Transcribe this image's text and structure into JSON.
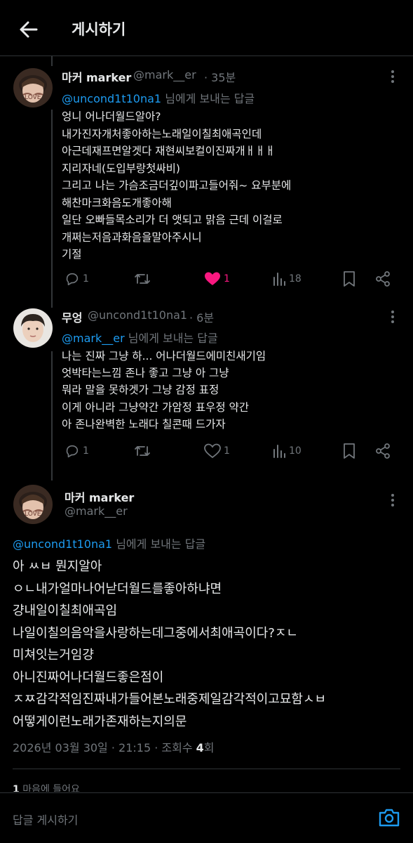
{
  "header": {
    "title": "게시하기",
    "back_icon": "arrow-left-icon"
  },
  "replying_label": "님에게 보내는 답글",
  "tweets": [
    {
      "name": "마커 marker",
      "handle": "@mark__er",
      "time": "· 35분",
      "reply_to": "@uncond1t10na1",
      "lines": [
        "엉니 어나더월드알아?",
        "내가진자개처좋아하는노래일이칠최애곡인데",
        "아근데재프면알겟다 재현씨보컬이진짜개ㅐㅐㅐ",
        "지리자네(도입부랑첫싸비)",
        "그리고 나는 가슴조금더깊이파고들어줘~ 요부분에",
        "해찬마크화음도개좋아해",
        "일단 오빠들목소리가 더 앳되고 맑음 근데 이걸로",
        "개쩌는저음과화음을말아주시니",
        "기절"
      ],
      "actions": {
        "replies": "1",
        "likes": "1",
        "views": "18"
      }
    },
    {
      "name": "무엉",
      "handle": "@uncond1t10na1",
      "time": "· 6분",
      "reply_to": "@mark__er",
      "lines": [
        "나는 진짜 그냥 하... 어나더월드에미친새기임",
        "엇박타는느낌 존나 좋고 그냥 아 그냥",
        "뭐라 말을 못하겟가 그냥 감정 표정",
        "이게 아니라 그냥약간 가암정 표우정 약간",
        "아 존나완벽한 노래다 칠콘때 드가자"
      ],
      "actions": {
        "replies": "1",
        "likes": "1",
        "views": "10"
      }
    }
  ],
  "main": {
    "name": "마커 marker",
    "handle": "@mark__er",
    "reply_to": "@uncond1t10na1",
    "lines": [
      "아 ㅆㅂ 뭔지알아",
      "ㅇㄴ내가얼마나어낟더월드를좋아하냐면",
      "걍내일이칠최애곡임",
      "나일이칠의음악을사랑하는데그중에서최애곡이다?ㅈㄴ",
      "미쳐잇는거임걍",
      "아니진짜어나더월드좋은점이",
      "ㅈㅉ감각적임진짜내가들어본노래중제일감각적이고묘함ㅅㅂ",
      "어떻게이런노래가존재하는지의문"
    ],
    "date": "2026년 03월 30일 · 21:15 · 조회수 ",
    "views": "4",
    "views_suffix": "회",
    "likes_count": "1",
    "likes_label": "마음에 들어요"
  },
  "compose": {
    "placeholder": "답글 게시하기",
    "camera_icon": "camera-icon"
  },
  "colors": {
    "background": "#000000",
    "link": "#1d9bf0",
    "like": "#f91880",
    "muted": "#71767b"
  }
}
